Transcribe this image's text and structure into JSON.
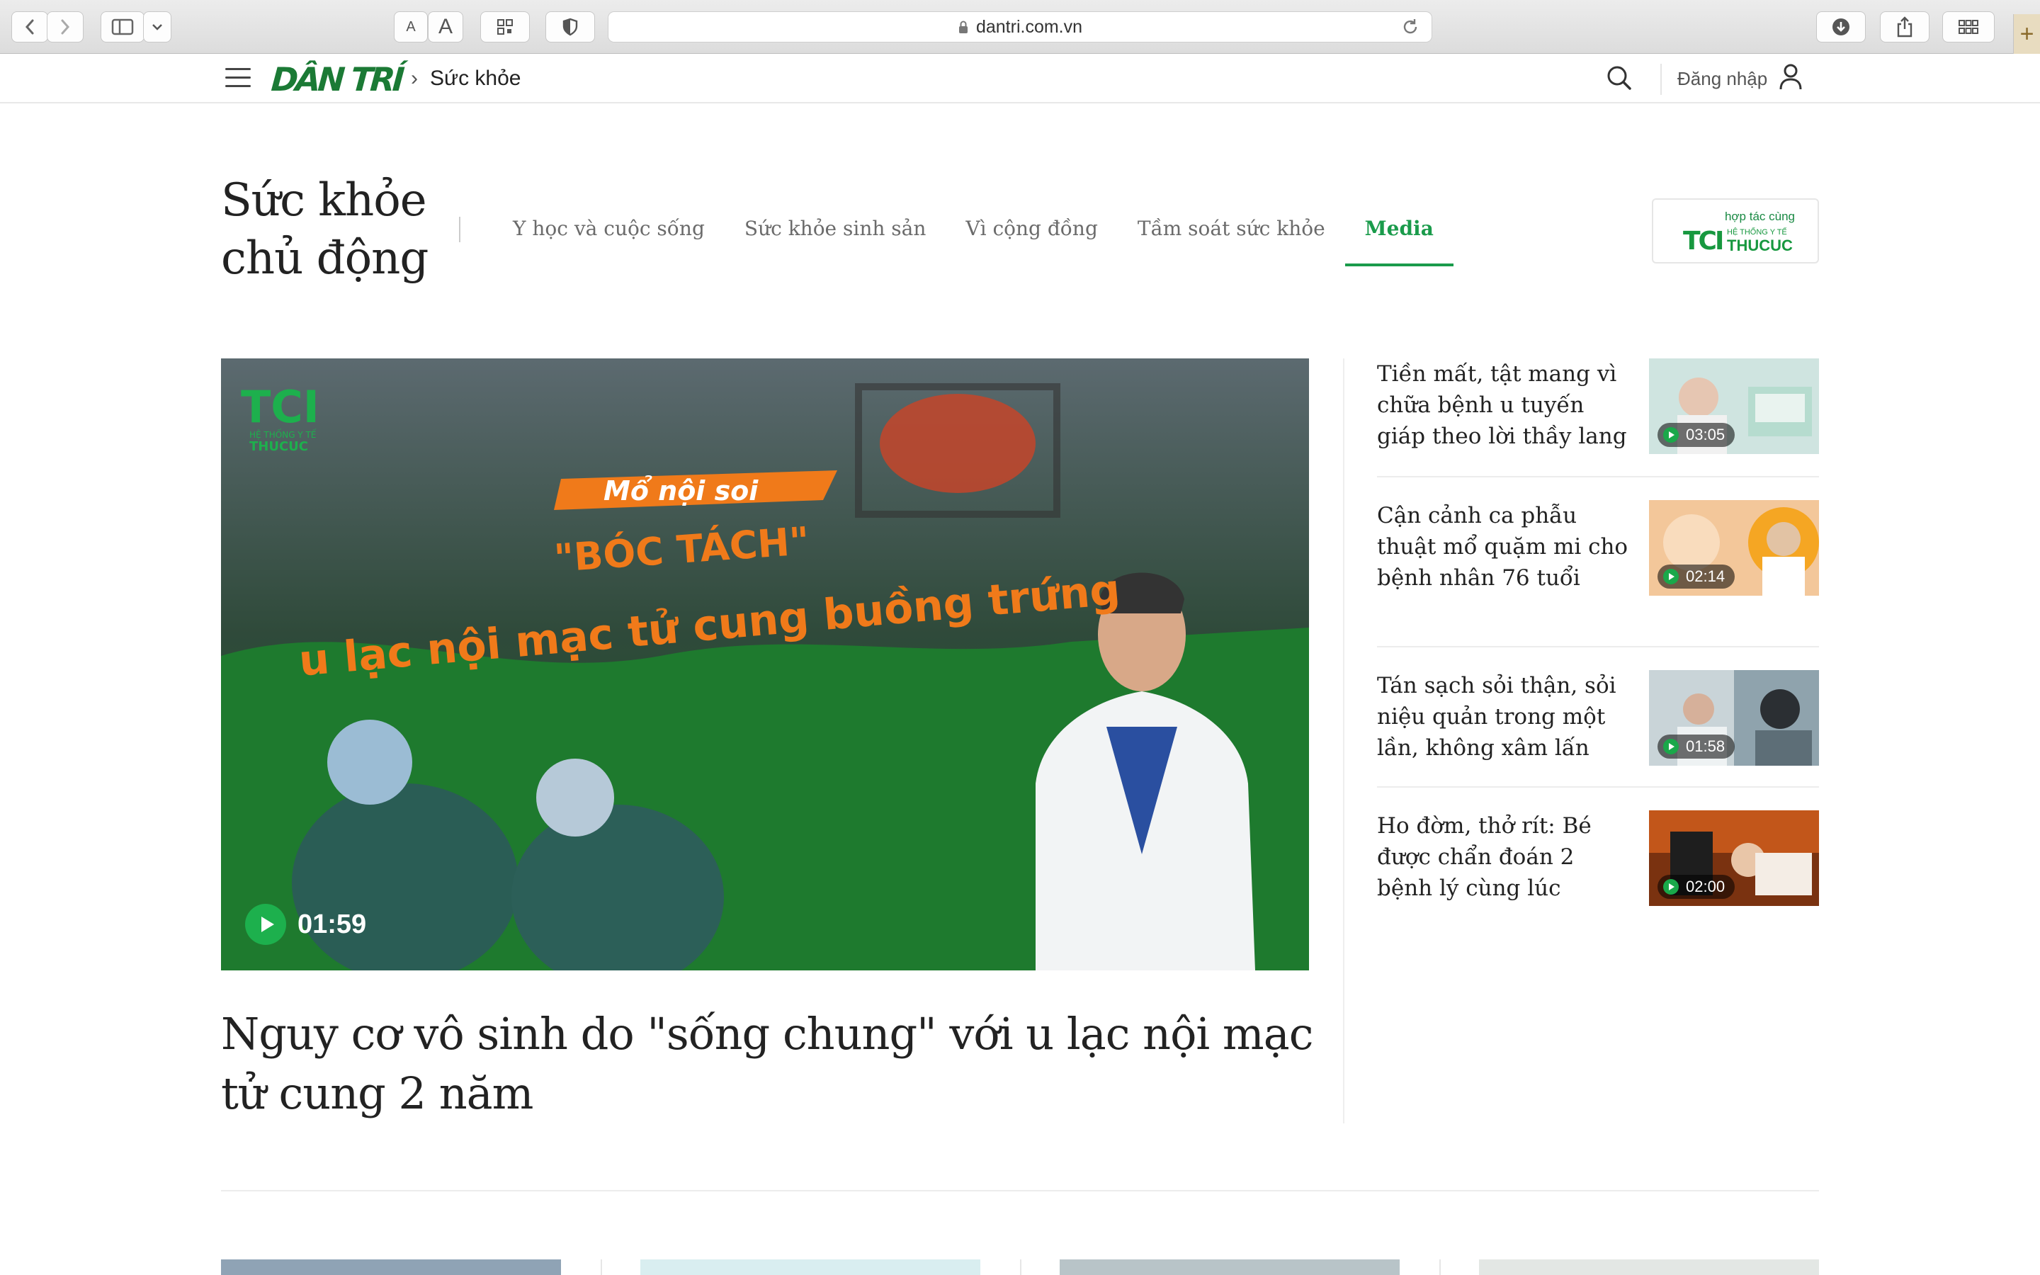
{
  "browser": {
    "url": "dantri.com.vn",
    "font_small_label": "A",
    "font_large_label": "A"
  },
  "header": {
    "logo": "DÂN TRÍ",
    "breadcrumb_separator": "›",
    "breadcrumb": "Sức khỏe",
    "login_label": "Đăng nhập"
  },
  "section": {
    "title": "Sức khỏe chủ động",
    "tabs": [
      {
        "label": "Y học và cuộc sống",
        "active": false
      },
      {
        "label": "Sức khỏe sinh sản",
        "active": false
      },
      {
        "label": "Vì cộng đồng",
        "active": false
      },
      {
        "label": "Tầm soát sức khỏe",
        "active": false
      },
      {
        "label": "Media",
        "active": true
      }
    ],
    "partner": {
      "caption": "hợp tác cùng",
      "logo": "TCI",
      "sub": "HỆ THỐNG Y TẾ",
      "name": "THUCUC"
    }
  },
  "featured": {
    "title": "Nguy cơ vô sinh do \"sống chung\" với u lạc nội mạc tử cung 2 năm",
    "duration": "01:59",
    "image_text": {
      "logo": "TCI",
      "logo_sub": "HỆ THỐNG Y TẾ",
      "logo_name": "THUCUC",
      "tag": "Mổ nội soi",
      "line1": "\"BÓC TÁCH\"",
      "line2": "u lạc nội mạc tử cung buồng trứng"
    }
  },
  "side_list": [
    {
      "title": "Tiền mất, tật mang vì chữa bệnh u tuyến giáp theo lời thầy lang",
      "duration": "03:05"
    },
    {
      "title": "Cận cảnh ca phẫu thuật mổ quặm mi cho bệnh nhân 76 tuổi",
      "duration": "02:14"
    },
    {
      "title": "Tán sạch sỏi thận, sỏi niệu quản trong một lần, không xâm lấn",
      "duration": "01:58"
    },
    {
      "title": "Ho đờm, thở rít: Bé được chẩn đoán 2 bệnh lý cùng lúc",
      "duration": "02:00"
    }
  ],
  "colors": {
    "accent": "#1a9b4b",
    "logo_green": "#1b7a35",
    "hero_green": "#1c6b2c",
    "hero_orange": "#f07a1a"
  },
  "icons": {
    "menu": "hamburger-icon",
    "search": "search-icon",
    "user": "user-icon",
    "play": "play-icon"
  }
}
